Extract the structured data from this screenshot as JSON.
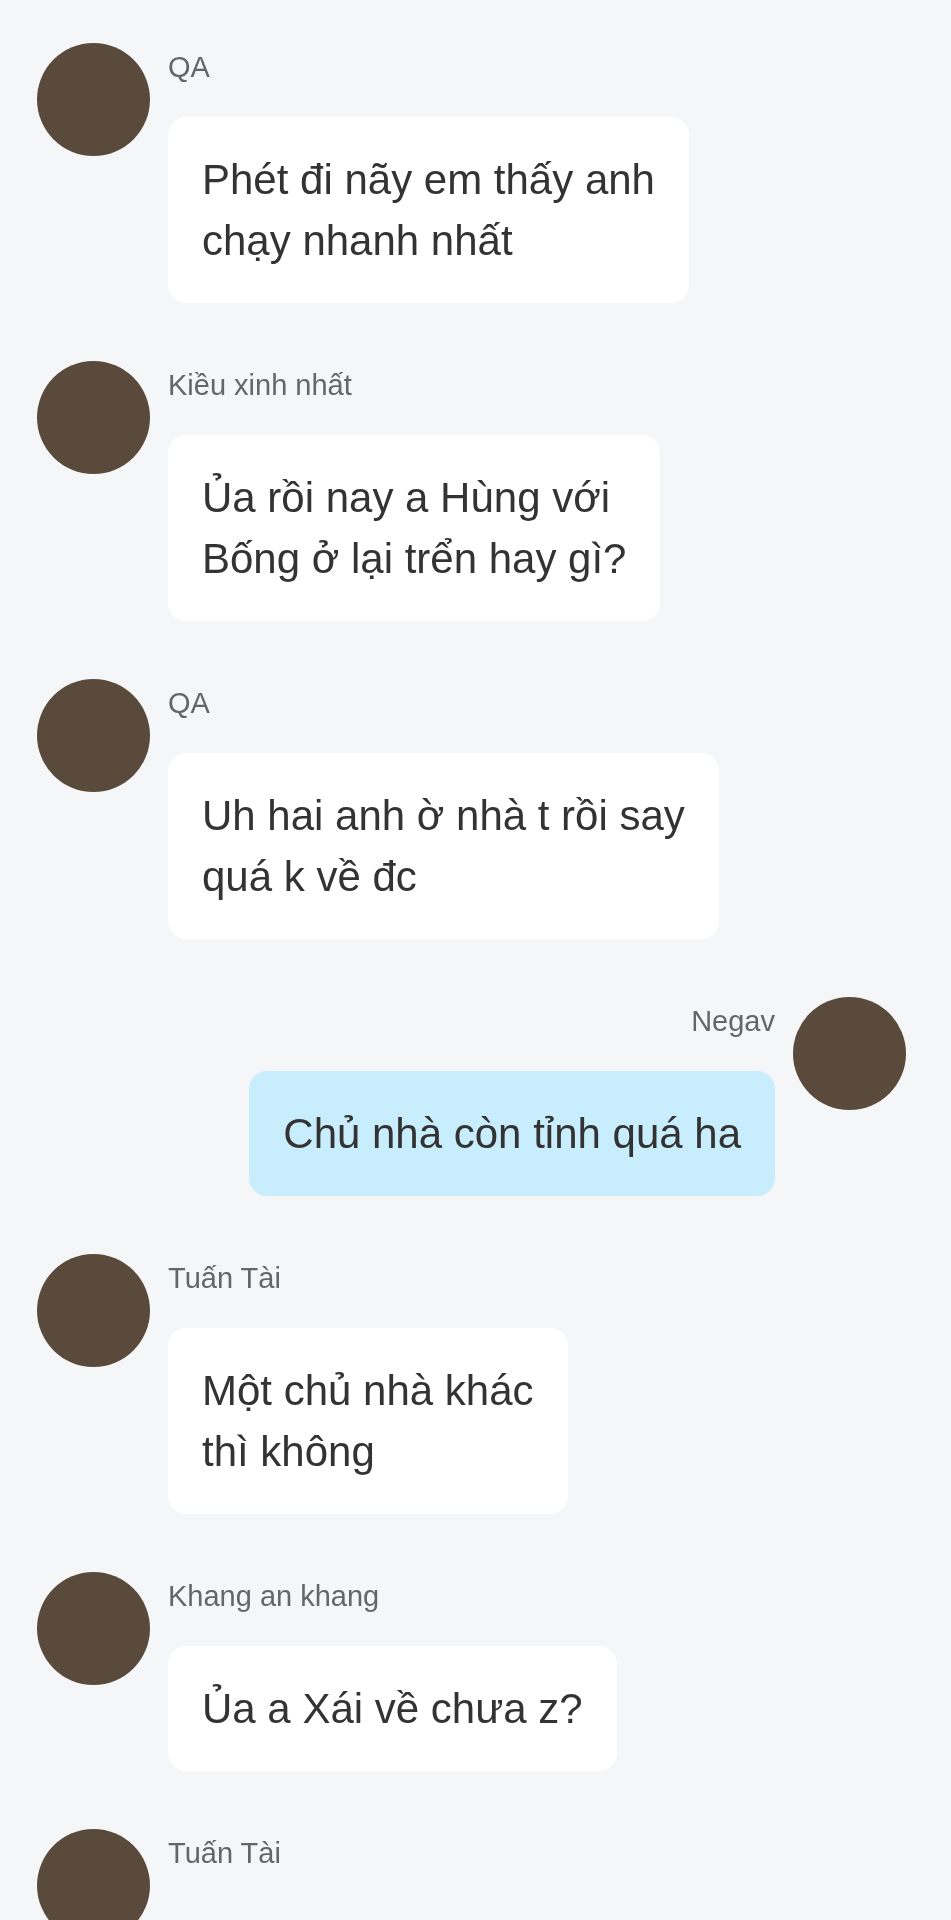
{
  "messages": [
    {
      "sender": "QA",
      "text": "Phét đi nãy em thấy anh\nchạy nhanh nhất",
      "outgoing": false
    },
    {
      "sender": "Kiều xinh nhất",
      "text": "Ủa rồi nay a Hùng với\nBống ở lại trển hay gì?",
      "outgoing": false
    },
    {
      "sender": "QA",
      "text": "Uh hai anh ờ nhà t rồi say\nquá k về đc",
      "outgoing": false
    },
    {
      "sender": "Negav",
      "text": "Chủ nhà còn tỉnh quá ha",
      "outgoing": true
    },
    {
      "sender": "Tuấn Tài",
      "text": "Một chủ nhà khác\nthì không",
      "outgoing": false
    },
    {
      "sender": "Khang an khang",
      "text": "Ủa a Xái về chưa z?",
      "outgoing": false
    },
    {
      "sender": "Tuấn Tài",
      "outgoing": false
    }
  ]
}
